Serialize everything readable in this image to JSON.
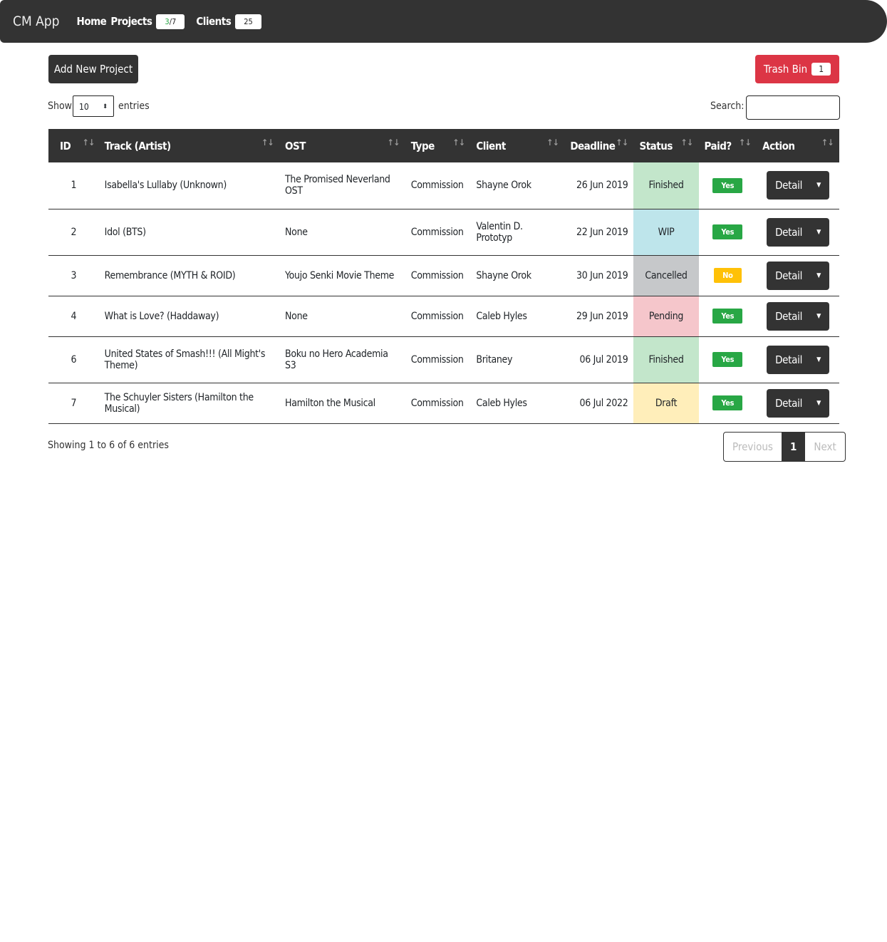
{
  "nav": {
    "brand": "CM App",
    "home": "Home",
    "projects": "Projects",
    "projects_done": "3",
    "projects_total": "/7",
    "clients": "Clients",
    "clients_count": "25"
  },
  "toolbar": {
    "add_project": "Add New Project",
    "trash": "Trash Bin",
    "trash_count": "1"
  },
  "filters": {
    "show": "Show",
    "entries_value": "10",
    "entries": "entries",
    "search": "Search:"
  },
  "table": {
    "headers": [
      "ID",
      "Track (Artist)",
      "OST",
      "Type",
      "Client",
      "Deadline",
      "Status",
      "Paid?",
      "Action"
    ],
    "rows": [
      {
        "id": "1",
        "track": "Isabella's Lullaby (Unknown)",
        "ost": "The Promised Neverland OST",
        "type": "Commission",
        "client": "Shayne Orok",
        "deadline": "26 Jun 2019",
        "status": "Finished",
        "status_color": "#c3e6cb",
        "paid": "Yes",
        "paid_color": "#28a745",
        "action": "Detail"
      },
      {
        "id": "2",
        "track": "Idol (BTS)",
        "ost": "None",
        "type": "Commission",
        "client": "Valentin D. Prototyp",
        "deadline": "22 Jun 2019",
        "status": "WIP",
        "status_color": "#bee5eb",
        "paid": "Yes",
        "paid_color": "#28a745",
        "action": "Detail"
      },
      {
        "id": "3",
        "track": "Remembrance (MYTH & ROID)",
        "ost": "Youjo Senki Movie Theme",
        "type": "Commission",
        "client": "Shayne Orok",
        "deadline": "30 Jun 2019",
        "status": "Cancelled",
        "status_color": "#c6c8ca",
        "paid": "No",
        "paid_color": "#ffc107",
        "action": "Detail"
      },
      {
        "id": "4",
        "track": "What is Love? (Haddaway)",
        "ost": "None",
        "type": "Commission",
        "client": "Caleb Hyles",
        "deadline": "29 Jun 2019",
        "status": "Pending",
        "status_color": "#f5c6cb",
        "paid": "Yes",
        "paid_color": "#28a745",
        "action": "Detail"
      },
      {
        "id": "6",
        "track": "United States of Smash!!! (All Might's Theme)",
        "ost": "Boku no Hero Academia S3",
        "type": "Commission",
        "client": "Britaney",
        "deadline": "06 Jul 2019",
        "status": "Finished",
        "status_color": "#c3e6cb",
        "paid": "Yes",
        "paid_color": "#28a745",
        "action": "Detail"
      },
      {
        "id": "7",
        "track": "The Schuyler Sisters (Hamilton the Musical)",
        "ost": "Hamilton the Musical",
        "type": "Commission",
        "client": "Caleb Hyles",
        "deadline": "06 Jul 2022",
        "status": "Draft",
        "status_color": "#ffeeba",
        "paid": "Yes",
        "paid_color": "#28a745",
        "action": "Detail"
      }
    ]
  },
  "footer": {
    "info": "Showing 1 to 6 of 6 entries",
    "previous": "Previous",
    "page": "1",
    "next": "Next"
  }
}
